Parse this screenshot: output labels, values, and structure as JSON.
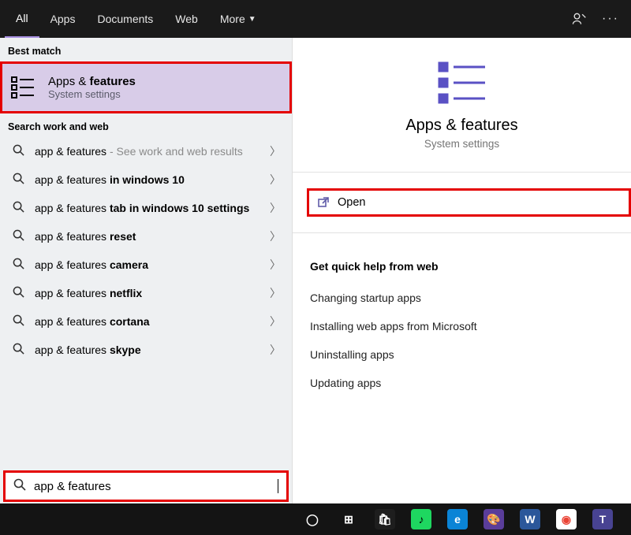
{
  "header": {
    "tabs": [
      {
        "label": "All",
        "active": true
      },
      {
        "label": "Apps"
      },
      {
        "label": "Documents"
      },
      {
        "label": "Web"
      },
      {
        "label": "More"
      }
    ]
  },
  "left": {
    "best_match_label": "Best match",
    "best_match": {
      "title_prefix": "Apps & ",
      "title_bold": "features",
      "subtitle": "System settings"
    },
    "web_label": "Search work and web",
    "results": [
      {
        "prefix": "app & features",
        "suffix": "",
        "muted": " - See work and web results"
      },
      {
        "prefix": "app & features ",
        "bold": "in windows 10"
      },
      {
        "prefix": "app & features ",
        "bold": "tab in windows 10 settings"
      },
      {
        "prefix": "app & features ",
        "bold": "reset"
      },
      {
        "prefix": "app & features ",
        "bold": "camera"
      },
      {
        "prefix": "app & features ",
        "bold": "netflix"
      },
      {
        "prefix": "app & features ",
        "bold": "cortana"
      },
      {
        "prefix": "app & features ",
        "bold": "skype"
      }
    ]
  },
  "right": {
    "hero_title": "Apps & features",
    "hero_sub": "System settings",
    "open_label": "Open",
    "help_header": "Get quick help from web",
    "help_links": [
      "Changing startup apps",
      "Installing web apps from Microsoft",
      "Uninstalling apps",
      "Updating apps"
    ]
  },
  "search": {
    "value": "app & features"
  },
  "taskbar": {
    "apps": [
      {
        "name": "cortana",
        "bg": "#ffffff00",
        "fg": "#ffffff",
        "glyph": "◯"
      },
      {
        "name": "taskview",
        "bg": "#ffffff00",
        "fg": "#ffffff",
        "glyph": "⊞"
      },
      {
        "name": "store",
        "bg": "#1e1e1e",
        "fg": "#ffffff",
        "glyph": "🛍"
      },
      {
        "name": "spotify",
        "bg": "#1ed760",
        "fg": "#000000",
        "glyph": "♪"
      },
      {
        "name": "edge",
        "bg": "#0a84d6",
        "fg": "#ffffff",
        "glyph": "e"
      },
      {
        "name": "paint",
        "bg": "#5a3d9a",
        "fg": "#ffffff",
        "glyph": "🎨"
      },
      {
        "name": "word",
        "bg": "#2b579a",
        "fg": "#ffffff",
        "glyph": "W"
      },
      {
        "name": "chrome",
        "bg": "#ffffff",
        "fg": "#ea4335",
        "glyph": "◉"
      },
      {
        "name": "teams",
        "bg": "#484392",
        "fg": "#ffffff",
        "glyph": "T"
      }
    ]
  }
}
